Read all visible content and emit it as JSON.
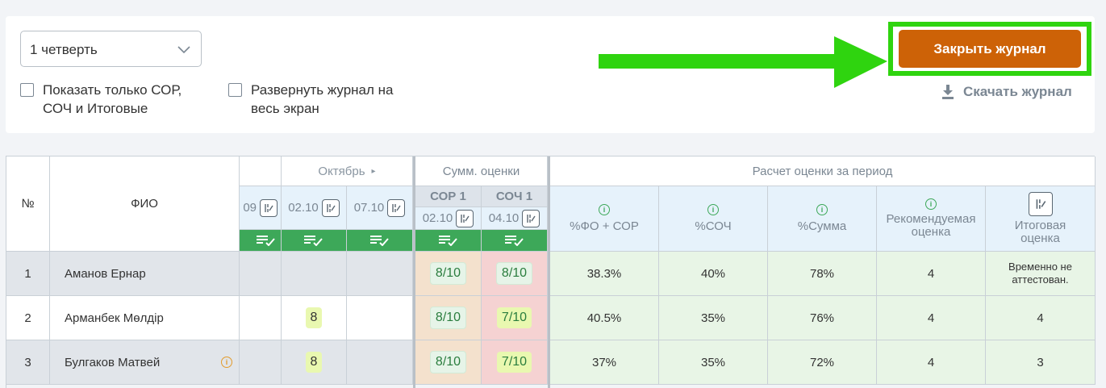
{
  "controls": {
    "quarter_select": "1 четверть",
    "checkbox_show_only": "Показать только СОР, СОЧ и Итоговые",
    "checkbox_fullscreen": "Развернуть журнал на весь экран",
    "close_journal": "Закрыть журнал",
    "download_journal": "Скачать журнал"
  },
  "table": {
    "col_no": "№",
    "col_fio": "ФИО",
    "month": "Октябрь",
    "month_arrow": "▸",
    "sum_header": "Сумм. оценки",
    "calc_header": "Расчет оценки за период",
    "dates": [
      "09",
      "02.10",
      "07.10"
    ],
    "sum_cols": [
      {
        "name": "СОР 1",
        "date": "02.10"
      },
      {
        "name": "СОЧ 1",
        "date": "04.10"
      }
    ],
    "calc_cols": [
      "%ФО + СОР",
      "%СОЧ",
      "%Сумма",
      "Рекомендуемая оценка",
      "Итоговая оценка"
    ],
    "rows": [
      {
        "no": "1",
        "name": "Аманов Ернар",
        "marks": [
          "",
          "",
          ""
        ],
        "sor": "8/10",
        "soch": "8/10",
        "fo_sor": "38.3%",
        "soch_pct": "40%",
        "sum": "78%",
        "recommended": "4",
        "final": "Временно не аттестован."
      },
      {
        "no": "2",
        "name": "Арманбек Мөлдір",
        "marks": [
          "",
          "8",
          ""
        ],
        "sor": "8/10",
        "soch": "7/10",
        "fo_sor": "40.5%",
        "soch_pct": "35%",
        "sum": "76%",
        "recommended": "4",
        "final": "4"
      },
      {
        "no": "3",
        "name": "Булгаков Матвей",
        "marks": [
          "",
          "8",
          ""
        ],
        "sor": "8/10",
        "soch": "7/10",
        "fo_sor": "37%",
        "soch_pct": "35%",
        "sum": "72%",
        "recommended": "4",
        "final": "3"
      }
    ]
  },
  "colors": {
    "close_button": "#cd6207",
    "highlight_frame": "#2fd40f",
    "green_bar": "#3da859"
  }
}
